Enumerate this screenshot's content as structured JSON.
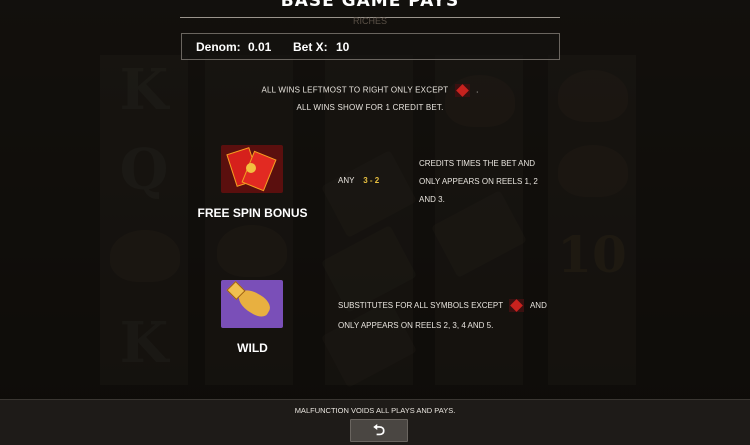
{
  "header": {
    "title": "BASE GAME PAYS",
    "subtitle": "RICHES"
  },
  "denom": {
    "denom_label": "Denom:",
    "denom_value": "0.01",
    "bet_label": "Bet X:",
    "bet_value": "10"
  },
  "rules": {
    "line1": "ALL WINS LEFTMOST TO RIGHT ONLY EXCEPT",
    "line1_end": ".",
    "line2": "ALL WINS SHOW FOR 1 CREDIT BET."
  },
  "symbols": [
    {
      "label": "FREE SPIN BONUS",
      "icon": "red-envelope-icon",
      "pay_prefix": "ANY",
      "pay_amount": "3 - 2",
      "desc_line1": "CREDITS TIMES THE BET AND",
      "desc_line2": "ONLY APPEARS ON REELS 1, 2",
      "desc_line3": "AND 3."
    },
    {
      "label": "WILD",
      "icon": "dragon-icon",
      "desc_line1": "SUBSTITUTES FOR ALL SYMBOLS EXCEPT",
      "desc_line1_end": "AND",
      "desc_line2": "ONLY APPEARS ON REELS 2, 3, 4 AND 5."
    }
  ],
  "footer": {
    "notice": "MALFUNCTION VOIDS ALL PLAYS AND PAYS.",
    "back_icon": "return-arrow-icon",
    "back_glyph": "⮌"
  },
  "background_reels": {
    "reel1": [
      "K",
      "Q",
      "",
      "K"
    ],
    "reel5_number": "10"
  },
  "colors": {
    "accent_gold": "#e8c040",
    "scatter_red": "#c8221e",
    "wild_purple": "#7a4fb8"
  }
}
